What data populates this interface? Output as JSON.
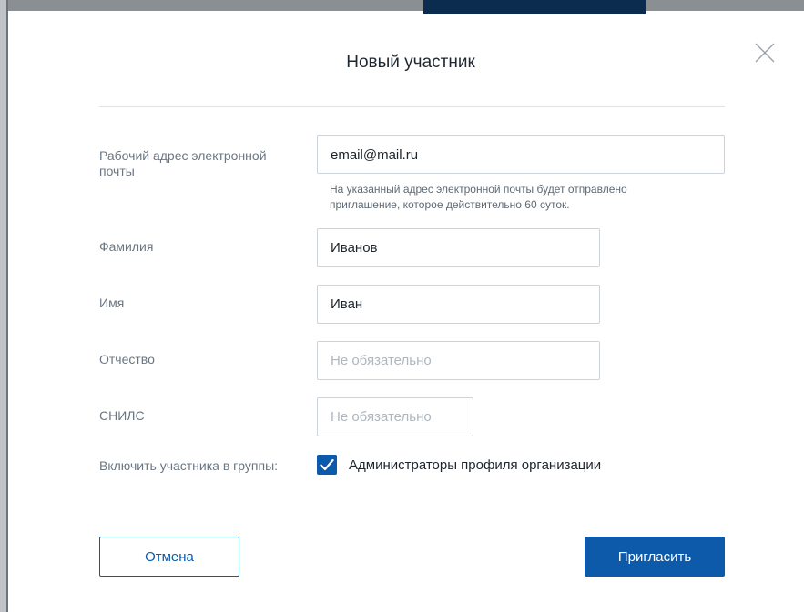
{
  "dialog": {
    "title": "Новый участник"
  },
  "form": {
    "email": {
      "label": "Рабочий адрес электронной почты",
      "value": "email@mail.ru",
      "hint": "На указанный адрес электронной почты будет отправлено приглашение, которое действительно 60 суток."
    },
    "surname": {
      "label": "Фамилия",
      "value": "Иванов"
    },
    "name": {
      "label": "Имя",
      "value": "Иван"
    },
    "patronymic": {
      "label": "Отчество",
      "value": "",
      "placeholder": "Не обязательно"
    },
    "snils": {
      "label": "СНИЛС",
      "value": "",
      "placeholder": "Не обязательно"
    },
    "groups": {
      "label": "Включить участника в группы:",
      "option_label": "Администраторы профиля организации",
      "checked": true
    }
  },
  "actions": {
    "cancel_label": "Отмена",
    "invite_label": "Пригласить"
  },
  "colors": {
    "primary": "#0d5aab",
    "label_text": "#6a7682",
    "border": "#ccd3da"
  },
  "icons": {
    "close": "close-icon",
    "check": "checkmark-icon"
  }
}
